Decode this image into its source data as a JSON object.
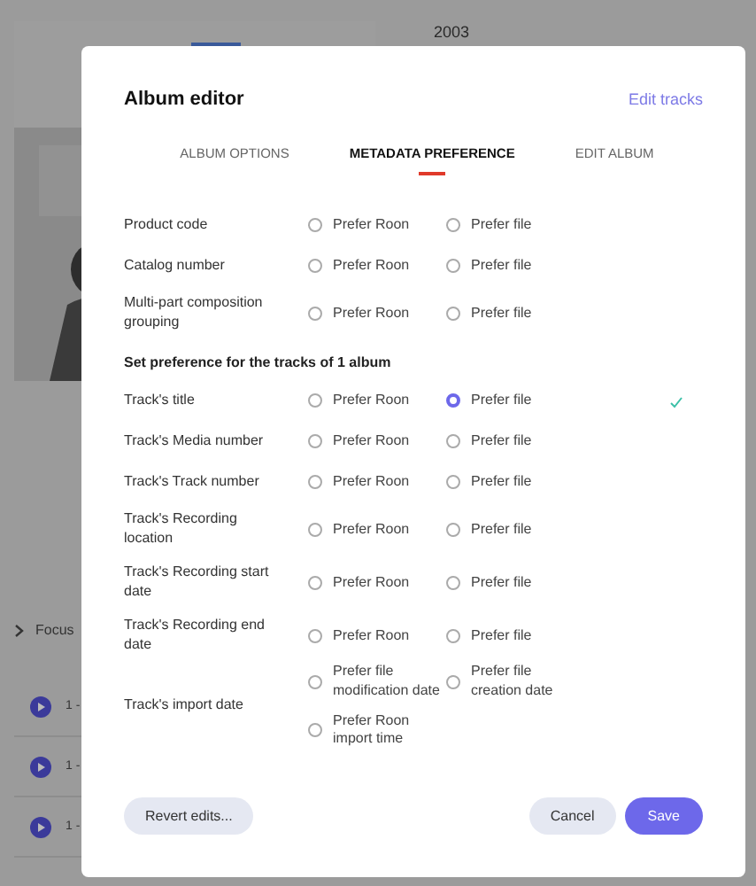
{
  "background": {
    "year": "2003",
    "section": "Focus",
    "tracks": [
      {
        "text": "1 -"
      },
      {
        "text": "1 -"
      },
      {
        "text": "1 -"
      }
    ]
  },
  "dialog": {
    "title": "Album editor",
    "link": "Edit tracks",
    "tabs": [
      {
        "label": "ALBUM OPTIONS",
        "selected": false
      },
      {
        "label": "METADATA PREFERENCE",
        "selected": true
      },
      {
        "label": "EDIT ALBUM",
        "selected": false
      }
    ],
    "album_rows": [
      {
        "label": "Product code",
        "applied": false,
        "options": [
          {
            "label": "Prefer Roon",
            "selected": false
          },
          {
            "label": "Prefer file",
            "selected": false
          }
        ]
      },
      {
        "label": "Catalog number",
        "applied": false,
        "options": [
          {
            "label": "Prefer Roon",
            "selected": false
          },
          {
            "label": "Prefer file",
            "selected": false
          }
        ]
      },
      {
        "label": "Multi-part composition grouping",
        "applied": false,
        "options": [
          {
            "label": "Prefer Roon",
            "selected": false
          },
          {
            "label": "Prefer file",
            "selected": false
          }
        ]
      }
    ],
    "section_heading": "Set preference for the tracks of 1 album",
    "track_rows": [
      {
        "label": "Track's title",
        "applied": true,
        "options": [
          {
            "label": "Prefer Roon",
            "selected": false
          },
          {
            "label": "Prefer file",
            "selected": true
          }
        ]
      },
      {
        "label": "Track's Media number",
        "applied": false,
        "options": [
          {
            "label": "Prefer Roon",
            "selected": false
          },
          {
            "label": "Prefer file",
            "selected": false
          }
        ]
      },
      {
        "label": "Track's Track number",
        "applied": false,
        "options": [
          {
            "label": "Prefer Roon",
            "selected": false
          },
          {
            "label": "Prefer file",
            "selected": false
          }
        ]
      },
      {
        "label": "Track's Recording location",
        "applied": false,
        "options": [
          {
            "label": "Prefer Roon",
            "selected": false
          },
          {
            "label": "Prefer file",
            "selected": false
          }
        ]
      },
      {
        "label": "Track's Recording start date",
        "applied": false,
        "options": [
          {
            "label": "Prefer Roon",
            "selected": false
          },
          {
            "label": "Prefer file",
            "selected": false
          }
        ]
      },
      {
        "label": "Track's Recording end date",
        "applied": false,
        "options": [
          {
            "label": "Prefer Roon",
            "selected": false
          },
          {
            "label": "Prefer file",
            "selected": false
          }
        ]
      },
      {
        "label": "Track's import date",
        "applied": false,
        "options": [
          {
            "label": "Prefer file modification date",
            "selected": false
          },
          {
            "label": "Prefer file creation date",
            "selected": false
          },
          {
            "label": "Prefer Roon import time",
            "selected": false
          }
        ]
      }
    ],
    "buttons": [
      {
        "label": "Revert edits...",
        "kind": "secondary"
      },
      {
        "label": "Cancel",
        "kind": "secondary"
      },
      {
        "label": "Save",
        "kind": "primary"
      }
    ]
  }
}
